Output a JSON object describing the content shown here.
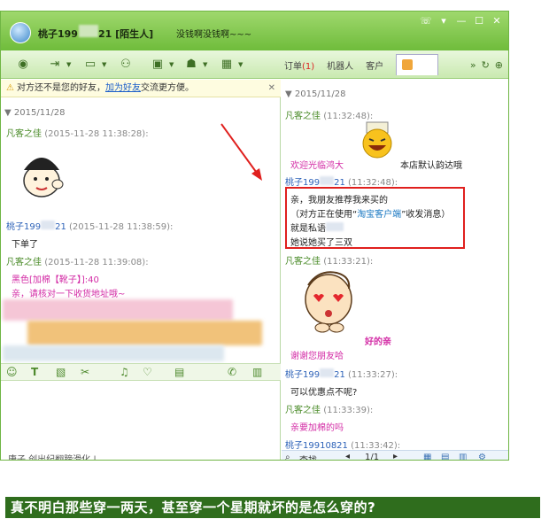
{
  "window": {
    "title_name": "桃子199",
    "title_suffix": "21 [陌生人]",
    "signature": "没钱啊没钱啊~~~"
  },
  "right_tabs": {
    "orders_label": "订单",
    "orders_count": "(1)",
    "robot_label": "机器人",
    "customer_label": "客户"
  },
  "notice": {
    "text_before": "对方还不是您的好友，",
    "link": "加为好友",
    "text_after": "交流更方便。"
  },
  "left_chat": {
    "date": "2015/11/28",
    "messages": [
      {
        "sender": "凡客之佳",
        "time": "(2015-11-28 11:38:28):",
        "lines": []
      },
      {
        "sender": "桃子199",
        "sender_tail": "21",
        "time": "(2015-11-28 11:38:59):",
        "lines": [
          "下单了"
        ]
      },
      {
        "sender": "凡客之佳",
        "time": "(2015-11-28 11:39:08):",
        "lines": [
          "黑色[加棉【靴子】]:40",
          "亲，请核对一下收货地址哦~"
        ]
      }
    ],
    "last_line": "唐子  创出纪翻蹄滑化  |"
  },
  "right_chat": {
    "date": "2015/11/28",
    "messages": [
      {
        "sender": "凡客之佳",
        "time": "(11:32:48):",
        "lines": [
          "欢迎光临鸿大",
          "本店默认韵达哦"
        ]
      },
      {
        "sender": "桃子199",
        "sender_tail": "21",
        "time": "(11:32:48):",
        "lines": [
          "亲，我朋友推荐我来买的",
          "（对方正在使用“",
          "淘宝客户端",
          "”收发消息）",
          "就是私语",
          "她说她买了三双"
        ]
      },
      {
        "sender": "凡客之佳",
        "time": "(11:33:21):",
        "lines": [
          "好的亲",
          "谢谢您朋友哈"
        ]
      },
      {
        "sender": "桃子199",
        "sender_tail": "21",
        "time": "(11:33:27):",
        "lines": [
          "可以优惠点不呢?"
        ]
      },
      {
        "sender": "凡客之佳",
        "time": "(11:33:39):",
        "lines": [
          "亲要加棉的吗"
        ]
      },
      {
        "sender": "桃子199",
        "sender_tail": "10821",
        "time": "(11:33:42):",
        "lines": []
      }
    ],
    "search_label": "查找",
    "page": "1/1"
  },
  "caption": "真不明白那些穿一两天，甚至穿一个星期就坏的是怎么穿的?"
}
